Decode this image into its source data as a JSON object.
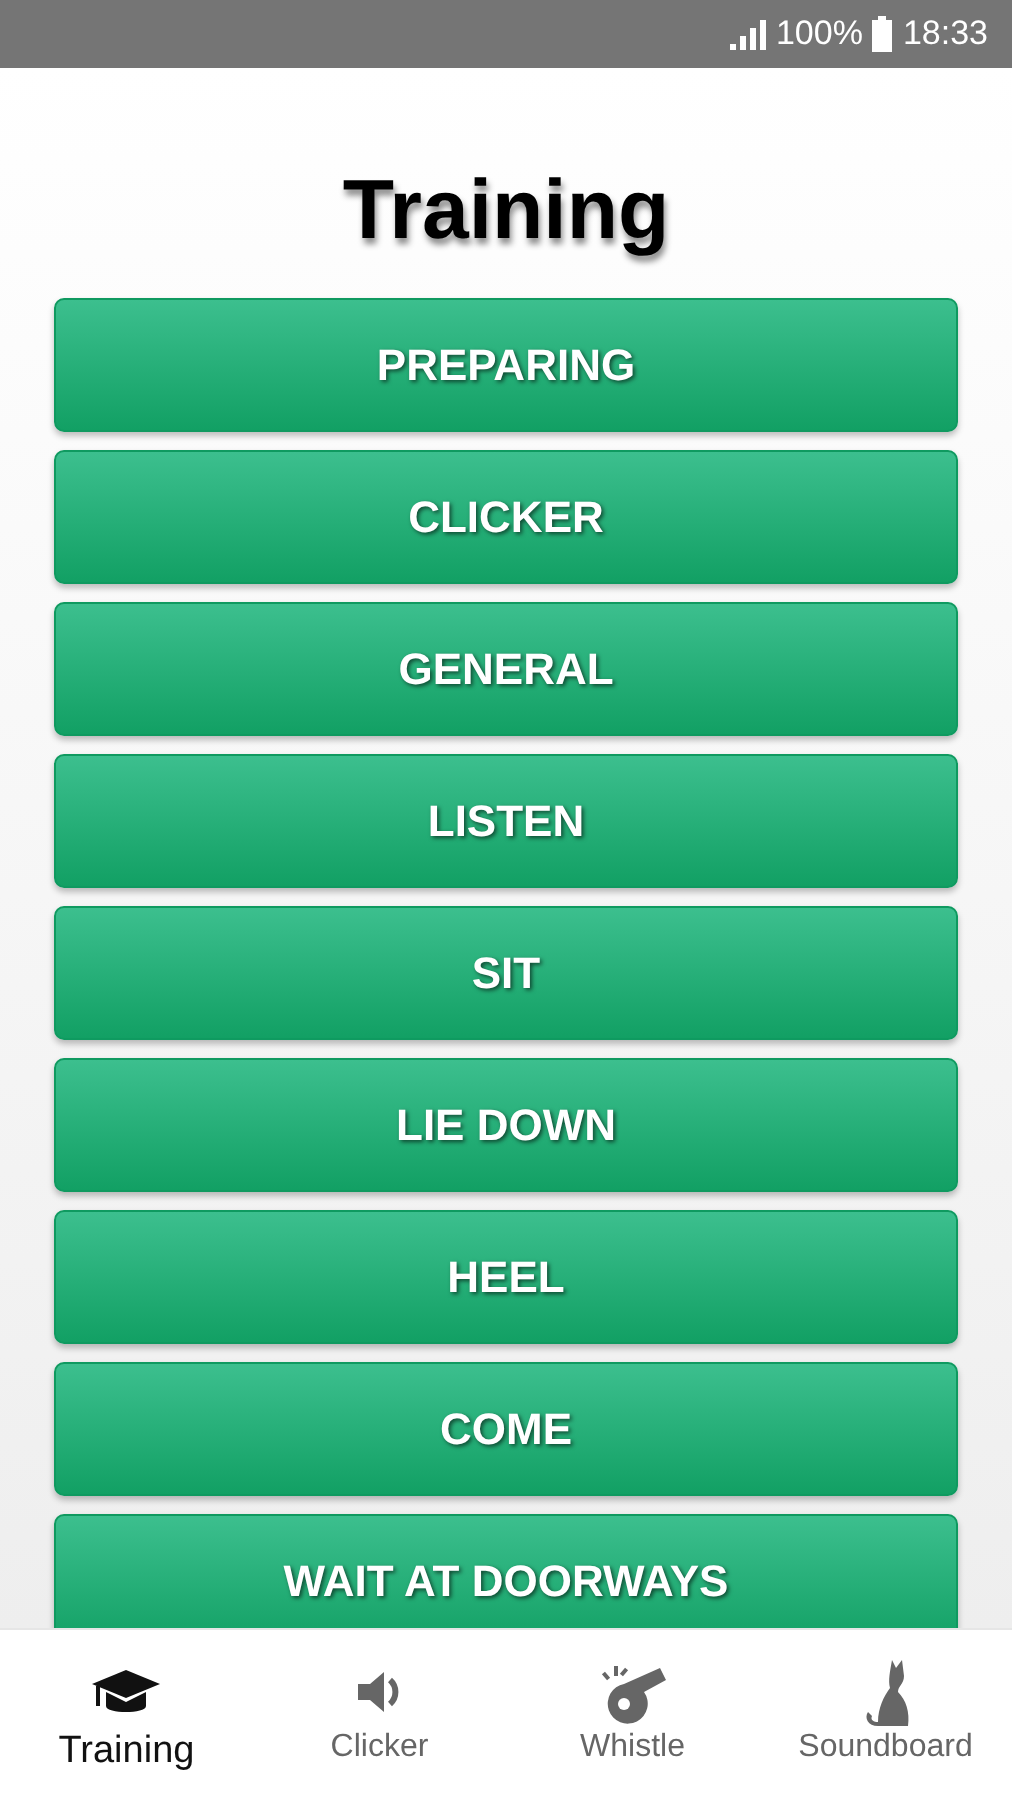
{
  "status_bar": {
    "battery": "100%",
    "time": "18:33"
  },
  "title": "Training",
  "buttons": [
    "PREPARING",
    "CLICKER",
    "GENERAL",
    "LISTEN",
    "SIT",
    "LIE DOWN",
    "HEEL",
    "COME",
    "WAIT AT DOORWAYS"
  ],
  "bottom_nav": [
    {
      "label": "Training",
      "selected": true
    },
    {
      "label": "Clicker",
      "selected": false
    },
    {
      "label": "Whistle",
      "selected": false
    },
    {
      "label": "Soundboard",
      "selected": false
    }
  ]
}
